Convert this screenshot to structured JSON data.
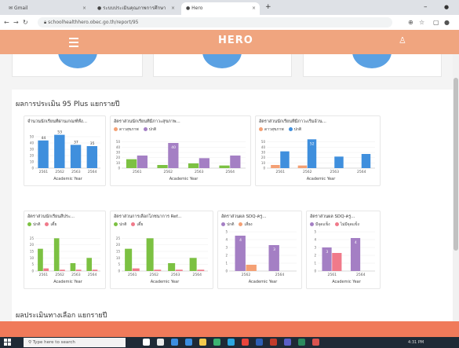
{
  "browser": {
    "tabs": [
      {
        "label": "Gmail"
      },
      {
        "label": "ระบบประเมินคุณภาพการศึกษา"
      },
      {
        "label": "Hero"
      }
    ],
    "new_tab": "+",
    "url": "schoolhealthhero.obec.go.th/report/95",
    "minimize": "–",
    "close": "●"
  },
  "app": {
    "brand": "HERO"
  },
  "section1": {
    "title": "ผลการประเมิน 95 Plus แยกรายปี"
  },
  "section2": {
    "title": "ผลประเมินทางเลือก แยกรายปี"
  },
  "colors": {
    "blue": "#3f8fdd",
    "orange": "#f4a074",
    "green": "#7cc142",
    "purple": "#a47fc4",
    "pink": "#f07a8a",
    "header": "#f0a57f",
    "footer": "#f07a5a"
  },
  "taskbar": {
    "search_placeholder": "Type here to search",
    "time": "4:31 PM"
  },
  "chart_data": [
    {
      "type": "bar",
      "title": "จำนวนนักเรียนที่ผ่านเกณฑ์ทั้ง...",
      "xlabel": "Academic Year",
      "categories": [
        "2561",
        "2562",
        "2563",
        "2564"
      ],
      "series": [
        {
          "values": [
            44,
            53,
            37,
            35
          ]
        }
      ],
      "ylim": [
        0,
        60
      ],
      "yticks": [
        "0",
        "10",
        "20",
        "30",
        "40",
        "50"
      ],
      "data_labels": [
        "44",
        "53",
        "37",
        "35"
      ]
    },
    {
      "type": "bar",
      "title": "อัตราส่วนนักเรียนที่มีภาวะสุขภาพ...",
      "xlabel": "Academic Year",
      "categories": [
        "2561",
        "2562",
        "2563",
        "2564"
      ],
      "series": [
        {
          "name": "ดาวสุขภาพ",
          "values": [
            17,
            6,
            9,
            5
          ]
        },
        {
          "name": "ปกติ",
          "values": [
            24,
            48,
            19,
            24
          ]
        }
      ],
      "ylim": [
        0,
        60
      ],
      "yticks": [
        "0",
        "10",
        "20",
        "30",
        "40",
        "50"
      ],
      "data_labels": [
        "",
        "40",
        "",
        ""
      ]
    },
    {
      "type": "bar",
      "title": "อัตราส่วนนักเรียนที่มีภาวะเริ่มอ้วน...",
      "xlabel": "Academic Year",
      "categories": [
        "2561",
        "2562",
        "2563",
        "2564"
      ],
      "series": [
        {
          "name": "ดาวสุขภาพ",
          "values": [
            6,
            5,
            0,
            0
          ]
        },
        {
          "name": "ปกติ",
          "values": [
            32,
            55,
            22,
            27
          ]
        }
      ],
      "ylim": [
        0,
        60
      ],
      "yticks": [
        "0",
        "10",
        "20",
        "30",
        "40",
        "50"
      ],
      "data_labels": [
        "",
        "52",
        "",
        ""
      ]
    },
    {
      "type": "bar",
      "title": "อัตราส่วนนักเรียนสี่ประ...",
      "xlabel": "Academic Year",
      "categories": [
        "2561",
        "2562",
        "2563",
        "2564"
      ],
      "series": [
        {
          "name": "ปกติ",
          "values": [
            17,
            25,
            6,
            10
          ]
        },
        {
          "name": "เตี้ย",
          "values": [
            2,
            1,
            1,
            1
          ]
        }
      ],
      "ylim": [
        0,
        30
      ],
      "yticks": [
        "0",
        "5",
        "10",
        "15",
        "20",
        "25"
      ]
    },
    {
      "type": "bar",
      "title": "อัตราส่วนการเลือกโภชนาการ Ref...",
      "xlabel": "Academic Year",
      "categories": [
        "2561",
        "2562",
        "2563",
        "2564"
      ],
      "series": [
        {
          "name": "ปกติ",
          "values": [
            17,
            25,
            6,
            10
          ]
        },
        {
          "name": "เตี้ย",
          "values": [
            2,
            1,
            1,
            1
          ]
        }
      ],
      "ylim": [
        0,
        30
      ],
      "yticks": [
        "0",
        "5",
        "10",
        "15",
        "20",
        "25"
      ]
    },
    {
      "type": "bar",
      "title": "อัตราส่วนผล SDQ-ครู...",
      "xlabel": "Academic Year",
      "categories": [
        "2562",
        "2564"
      ],
      "series": [
        {
          "name": "ปกติ",
          "values": [
            4.5,
            3.3
          ]
        },
        {
          "name": "เสี่ยง",
          "values": [
            0.8,
            0
          ]
        }
      ],
      "ylim": [
        0,
        5
      ],
      "yticks": [
        "0",
        "1",
        "2",
        "3",
        "4",
        "5"
      ],
      "data_labels": [
        "4",
        "3"
      ]
    },
    {
      "type": "bar",
      "title": "อัตราส่วนผล SDQ-ครู...",
      "xlabel": "Academic Year",
      "categories": [
        "2561",
        "2564"
      ],
      "series": [
        {
          "name": "มีจุดแข็ง",
          "values": [
            3,
            4.2
          ]
        },
        {
          "name": "ไม่มีจุดแข็ง",
          "values": [
            2.3,
            0
          ]
        }
      ],
      "ylim": [
        0,
        5
      ],
      "yticks": [
        "0",
        "1",
        "2",
        "3",
        "4",
        "5"
      ],
      "data_labels": [
        "3",
        "4"
      ]
    }
  ]
}
